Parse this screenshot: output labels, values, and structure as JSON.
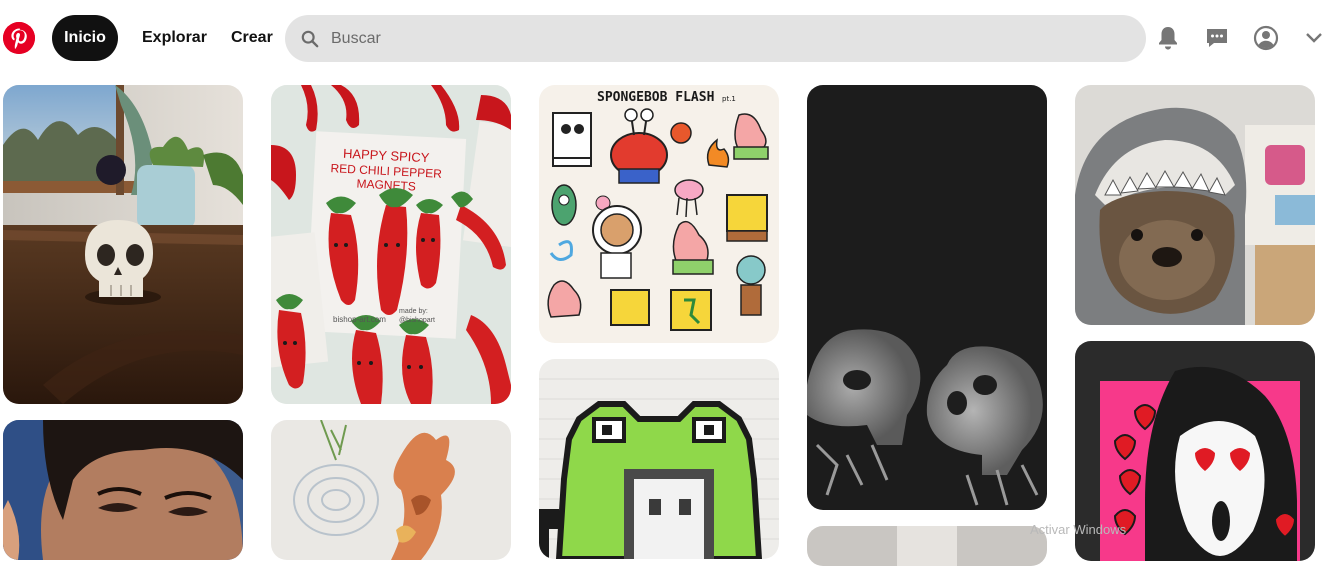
{
  "header": {
    "nav": {
      "home": "Inicio",
      "explore": "Explorar",
      "create": "Crear"
    },
    "search": {
      "placeholder": "Buscar",
      "value": ""
    },
    "icons": [
      "pinterest-logo",
      "search-icon",
      "bell-icon",
      "message-icon",
      "profile-icon",
      "chevron-down-icon"
    ]
  },
  "pins": {
    "chili": {
      "title_line1": "HAPPY SPICY",
      "title_line2": "RED CHILI PEPPER",
      "title_line3": "MAGNETS",
      "credit": "bishop-art.com",
      "credit_short": "made by:",
      "credit_handle": "@bishopart"
    },
    "spongebob": {
      "title": "SPONGEBOB FLASH",
      "subtitle": "pt.1"
    }
  },
  "watermark": "Activar Windows",
  "colors": {
    "brand": "#e60023",
    "nav_active_bg": "#111111",
    "search_bg": "#e3e3e3"
  }
}
